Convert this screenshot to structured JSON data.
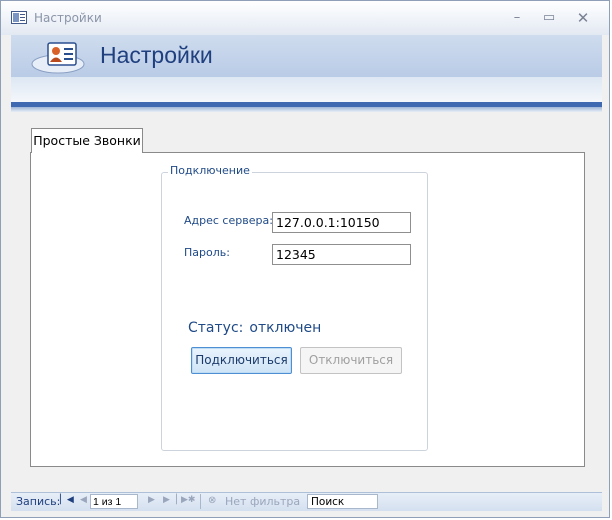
{
  "window": {
    "title": "Настройки",
    "controls": {
      "minimize": "–",
      "maximize": "▭",
      "close": "✕"
    }
  },
  "header": {
    "title": "Настройки",
    "icon": "contact-card-icon"
  },
  "tabs": [
    {
      "label": "Простые Звонки",
      "active": true
    }
  ],
  "connection": {
    "legend": "Подключение",
    "server_label": "Адрес сервера:",
    "server_value": "127.0.0.1:10150",
    "password_label": "Пароль:",
    "password_value": "12345",
    "status_label": "Статус:",
    "status_value": "отключен",
    "connect_button": "Подключиться",
    "disconnect_button": "Отключиться"
  },
  "navigation": {
    "record_label": "Запись:",
    "record_count": "1 из 1",
    "filter_label": "Нет фильтра",
    "search_value": "Поиск"
  },
  "colors": {
    "accent": "#3f6ab2",
    "label_text": "#1f4a87",
    "header_bg": "#b9cbe6"
  }
}
